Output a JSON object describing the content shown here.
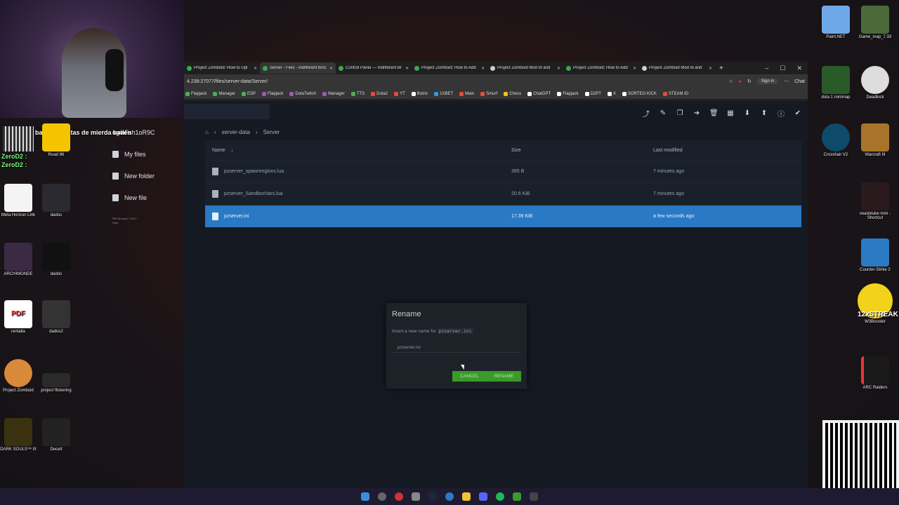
{
  "chat": [
    {
      "user": "",
      "text": "bailan ahoritas de mierda bailen"
    },
    {
      "user": "ZeroD2 :",
      "text": ""
    },
    {
      "user": "ZeroD2 :",
      "text": ""
    },
    {
      "user": "",
      "text": ""
    }
  ],
  "desktop_left": [
    {
      "label": "Road 96"
    },
    {
      "label": "Meta Horizon Link"
    },
    {
      "label": "dados"
    },
    {
      "label": "ARCHIMONDE"
    },
    {
      "label": "dados"
    },
    {
      "label": "rentalta"
    },
    {
      "label": "dados2"
    },
    {
      "label": "Project Zomboid"
    },
    {
      "label": "project flickering"
    },
    {
      "label": "DARK SOULS™ III"
    },
    {
      "label": "Deceit"
    }
  ],
  "desktop_right": [
    {
      "label": "Paint.NET"
    },
    {
      "label": "Game_map_7.33"
    },
    {
      "label": "dota 1 minimap"
    },
    {
      "label": "Deadlock"
    },
    {
      "label": "Crosshair V2"
    },
    {
      "label": "Warcraft III"
    },
    {
      "label": "veadotube mini - Shortcut"
    },
    {
      "label": "Counter-Strike 2"
    },
    {
      "label": "W3Booster"
    },
    {
      "label": "ARC Raiders"
    }
  ],
  "overlay_text": {
    "streak": "12xSTREAK",
    "pdf": "PDF"
  },
  "browser": {
    "tabs": [
      {
        "title": "Project Zomboid: How to Upl"
      },
      {
        "title": "Server - Files - indifferent broc"
      },
      {
        "title": "Control Panel — Indifferent Br"
      },
      {
        "title": "Project Zomboid: How to Add"
      },
      {
        "title": "Project Zomboid Mod Id and"
      },
      {
        "title": "Project Zomboid: How to Add"
      },
      {
        "title": "Project Zomboid Mod Id and"
      }
    ],
    "url": "4.238:27077/files/server-data/Server/",
    "signin": "Sign in",
    "chat_label": "Chat",
    "bookmarks": [
      {
        "label": "Flapjack",
        "color": "#4caf50"
      },
      {
        "label": "Manager",
        "color": "#4caf50"
      },
      {
        "label": "ESP",
        "color": "#4caf50"
      },
      {
        "label": "Flapjack",
        "color": "#9b59b6"
      },
      {
        "label": "DotaTwitch",
        "color": "#9b59b6"
      },
      {
        "label": "Manager",
        "color": "#9b59b6"
      },
      {
        "label": "TTS",
        "color": "#4caf50"
      },
      {
        "label": "Dota2",
        "color": "#e74c3c"
      },
      {
        "label": "YT",
        "color": "#e74c3c"
      },
      {
        "label": "Botrix",
        "color": "#ffffff"
      },
      {
        "label": "1XBET",
        "color": "#3498db"
      },
      {
        "label": "Main",
        "color": "#e74c3c"
      },
      {
        "label": "Smurf",
        "color": "#e74c3c"
      },
      {
        "label": "Chess",
        "color": "#f1c40f"
      },
      {
        "label": "ChatGPT",
        "color": "#ffffff"
      },
      {
        "label": "Flapjack",
        "color": "#ffffff"
      },
      {
        "label": "D2PT",
        "color": "#ffffff"
      },
      {
        "label": "X",
        "color": "#ffffff"
      },
      {
        "label": "SORTEO KICK",
        "color": "#ffffff"
      },
      {
        "label": "STEAM ID",
        "color": "#e74c3c"
      }
    ]
  },
  "app": {
    "sidebar": {
      "user": "ugmFsh1oR9C",
      "items": [
        {
          "label": "My files"
        },
        {
          "label": "New folder"
        },
        {
          "label": "New file"
        }
      ],
      "version": "File Browser 2.52.0",
      "help": "Help"
    },
    "breadcrumbs": [
      "server-data",
      "Server"
    ],
    "columns": {
      "name": "Name",
      "size": "Size",
      "modified": "Last modified"
    },
    "files": [
      {
        "name": "pzserver_spawnregions.lua",
        "size": "395 B",
        "modified": "7 minutes ago",
        "selected": false
      },
      {
        "name": "pzserver_SandboxVars.lua",
        "size": "20.6 KiB",
        "modified": "7 minutes ago",
        "selected": false
      },
      {
        "name": "pzserver.ini",
        "size": "17.39 KiB",
        "modified": "a few seconds ago",
        "selected": true
      }
    ],
    "modal": {
      "title": "Rename",
      "description": "Insert a new name for",
      "filename": "pzserver.ini",
      "input_value": "pzserver.ini",
      "cancel": "CANCEL",
      "rename": "RENAME"
    }
  }
}
